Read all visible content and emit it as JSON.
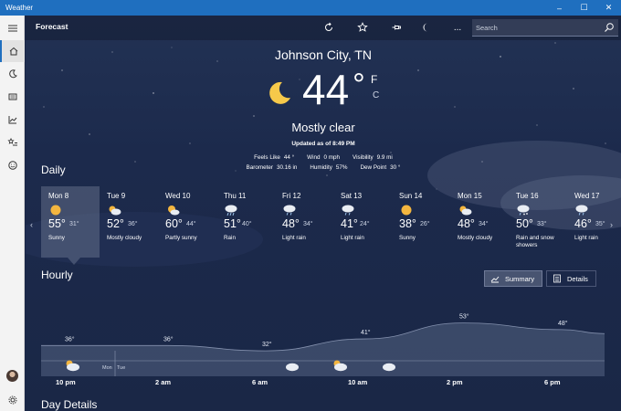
{
  "window": {
    "title": "Weather",
    "controls": [
      "–",
      "☐",
      "✕"
    ]
  },
  "sidebar": {
    "items": [
      {
        "icon": "hamburger-menu-icon"
      },
      {
        "icon": "home-icon"
      },
      {
        "icon": "moon-radar-icon"
      },
      {
        "icon": "news-icon"
      },
      {
        "icon": "chart-icon"
      },
      {
        "icon": "star-list-icon"
      },
      {
        "icon": "smiley-icon"
      }
    ],
    "bottom": [
      {
        "icon": "avatar"
      },
      {
        "icon": "gear-icon"
      }
    ]
  },
  "topbar": {
    "title": "Forecast",
    "actions": [
      "refresh-icon",
      "favorite-star-icon",
      "pin-icon",
      "dark-mode-moon-icon",
      "more-icon"
    ],
    "more_label": "...",
    "search_placeholder": "Search"
  },
  "current": {
    "city": "Johnson City, TN",
    "temperature": "44",
    "degree": "°",
    "unit_f": "F",
    "unit_c": "C",
    "condition": "Mostly clear",
    "updated": "Updated as of 8:49 PM",
    "stats_row1": [
      {
        "label": "Feels Like",
        "value": "44 °"
      },
      {
        "label": "Wind",
        "value": "0 mph"
      },
      {
        "label": "Visibility",
        "value": "9.9 mi"
      }
    ],
    "stats_row2": [
      {
        "label": "Barometer",
        "value": "30.16 in"
      },
      {
        "label": "Humidity",
        "value": "57%"
      },
      {
        "label": "Dew Point",
        "value": "30 °"
      }
    ]
  },
  "daily": {
    "title": "Daily",
    "days": [
      {
        "name": "Mon 8",
        "icon": "sun-icon",
        "high": "55°",
        "low": "31°",
        "condition": "Sunny",
        "selected": true
      },
      {
        "name": "Tue 9",
        "icon": "partly-cloudy-icon",
        "high": "52°",
        "low": "36°",
        "condition": "Mostly cloudy"
      },
      {
        "name": "Wed 10",
        "icon": "partly-sunny-icon",
        "high": "60°",
        "low": "44°",
        "condition": "Partly sunny"
      },
      {
        "name": "Thu 11",
        "icon": "rain-icon",
        "high": "51°",
        "low": "40°",
        "condition": "Rain"
      },
      {
        "name": "Fri 12",
        "icon": "light-rain-icon",
        "high": "48°",
        "low": "34°",
        "condition": "Light rain"
      },
      {
        "name": "Sat 13",
        "icon": "light-rain-icon",
        "high": "41°",
        "low": "24°",
        "condition": "Light rain"
      },
      {
        "name": "Sun 14",
        "icon": "sun-icon",
        "high": "38°",
        "low": "26°",
        "condition": "Sunny"
      },
      {
        "name": "Mon 15",
        "icon": "partly-cloudy-icon",
        "high": "48°",
        "low": "34°",
        "condition": "Mostly cloudy"
      },
      {
        "name": "Tue 16",
        "icon": "rain-snow-icon",
        "high": "50°",
        "low": "33°",
        "condition": "Rain and snow showers"
      },
      {
        "name": "Wed 17",
        "icon": "light-rain-icon",
        "high": "46°",
        "low": "35°",
        "condition": "Light rain"
      }
    ]
  },
  "hourly": {
    "title": "Hourly",
    "summary_label": "Summary",
    "details_label": "Details",
    "temps": [
      {
        "label": "36°",
        "value": 36,
        "hour": 0
      },
      {
        "label": "36°",
        "value": 36,
        "hour": 3
      },
      {
        "label": "32°",
        "value": 32,
        "hour": 6
      },
      {
        "label": "41°",
        "value": 41,
        "hour": 9
      },
      {
        "label": "53°",
        "value": 53,
        "hour": 12
      },
      {
        "label": "48°",
        "value": 48,
        "hour": 15
      }
    ],
    "times": [
      "10 pm",
      "2 am",
      "6 am",
      "10 am",
      "2 pm",
      "6 pm"
    ],
    "day_sep": [
      "Mon",
      "Tue"
    ],
    "icons": [
      "partly-cloudy-night-icon",
      "cloudy-icon",
      "partly-sunny-icon",
      "cloudy-icon"
    ]
  },
  "day_details": {
    "title": "Day Details"
  }
}
